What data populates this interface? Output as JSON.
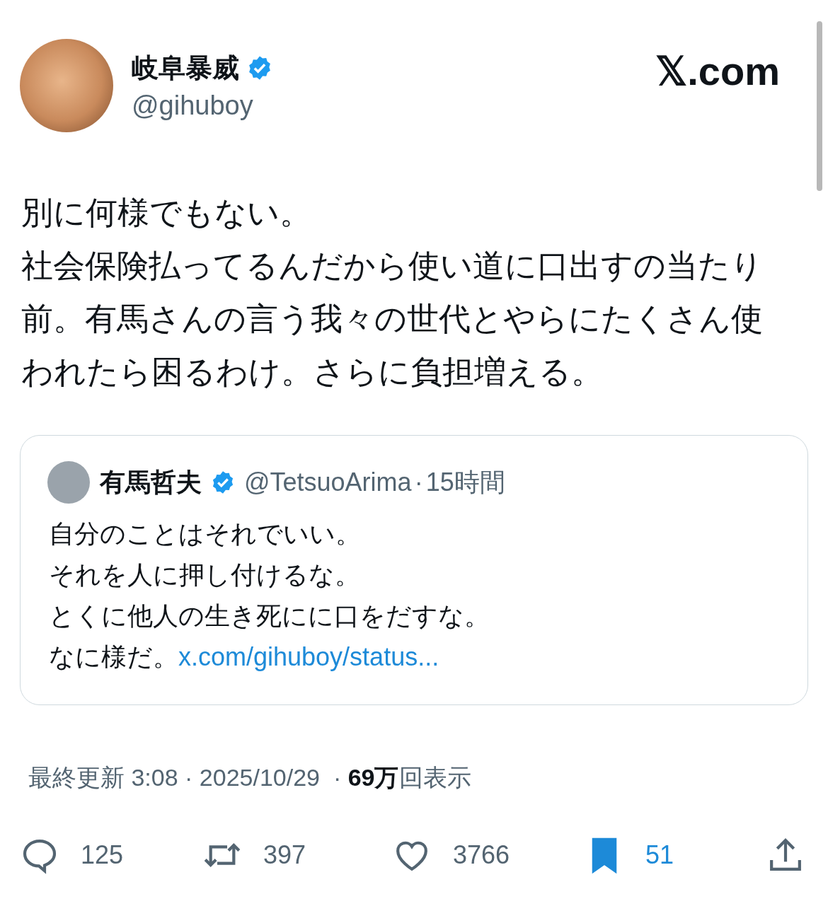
{
  "author": {
    "name": "岐阜暴威",
    "handle": "@gihuboy",
    "verified": true
  },
  "brand": "𝕏.com",
  "text": [
    "別に何様でもない。",
    "社会保険払ってるんだから使い道に口出すの当たり前。有馬さんの言う我々の世代とやらにたくさん使われたら困るわけ。さらに負担増える。"
  ],
  "quote": {
    "author": {
      "name": "有馬哲夫",
      "handle": "@TetsuoArima",
      "verified": true,
      "separator": "·",
      "time": "15時間"
    },
    "text": [
      "自分のことはそれでいい。",
      "それを人に押し付けるな。",
      "とくに他人の生き死にに口をだすな。",
      "なに様だ。"
    ],
    "link": "x.com/gihuboy/status..."
  },
  "meta": "最終更新 3:08 · 2025/10/29  · **69万**回表示",
  "actions": [
    {
      "kind": "reply",
      "count": "125",
      "selected": false
    },
    {
      "kind": "repost",
      "count": "397",
      "selected": false
    },
    {
      "kind": "like",
      "count": "3766",
      "selected": false
    },
    {
      "kind": "bookmark",
      "count": "51",
      "selected": true
    },
    {
      "kind": "share",
      "selected": false
    }
  ]
}
